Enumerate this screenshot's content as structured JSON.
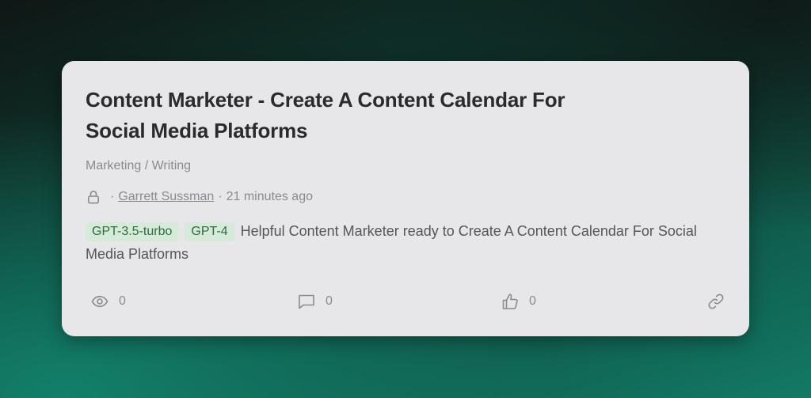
{
  "card": {
    "title": "Content Marketer - Create A Content Calendar For Social Media Platforms",
    "category": "Marketing / Writing",
    "meta": {
      "visibility_icon": "lock-icon",
      "separator": "·",
      "author": "Garrett Sussman",
      "time_ago": "21 minutes ago"
    },
    "tags": [
      "GPT-3.5-turbo",
      "GPT-4"
    ],
    "description": "Helpful Content Marketer ready to Create A Content Calendar For Social Media Platforms",
    "stats": {
      "views": "0",
      "comments": "0",
      "likes": "0"
    },
    "colors": {
      "card_bg": "#e7e7e9",
      "tag_bg": "#d5ead9",
      "tag_text": "#2f6b3f"
    }
  }
}
